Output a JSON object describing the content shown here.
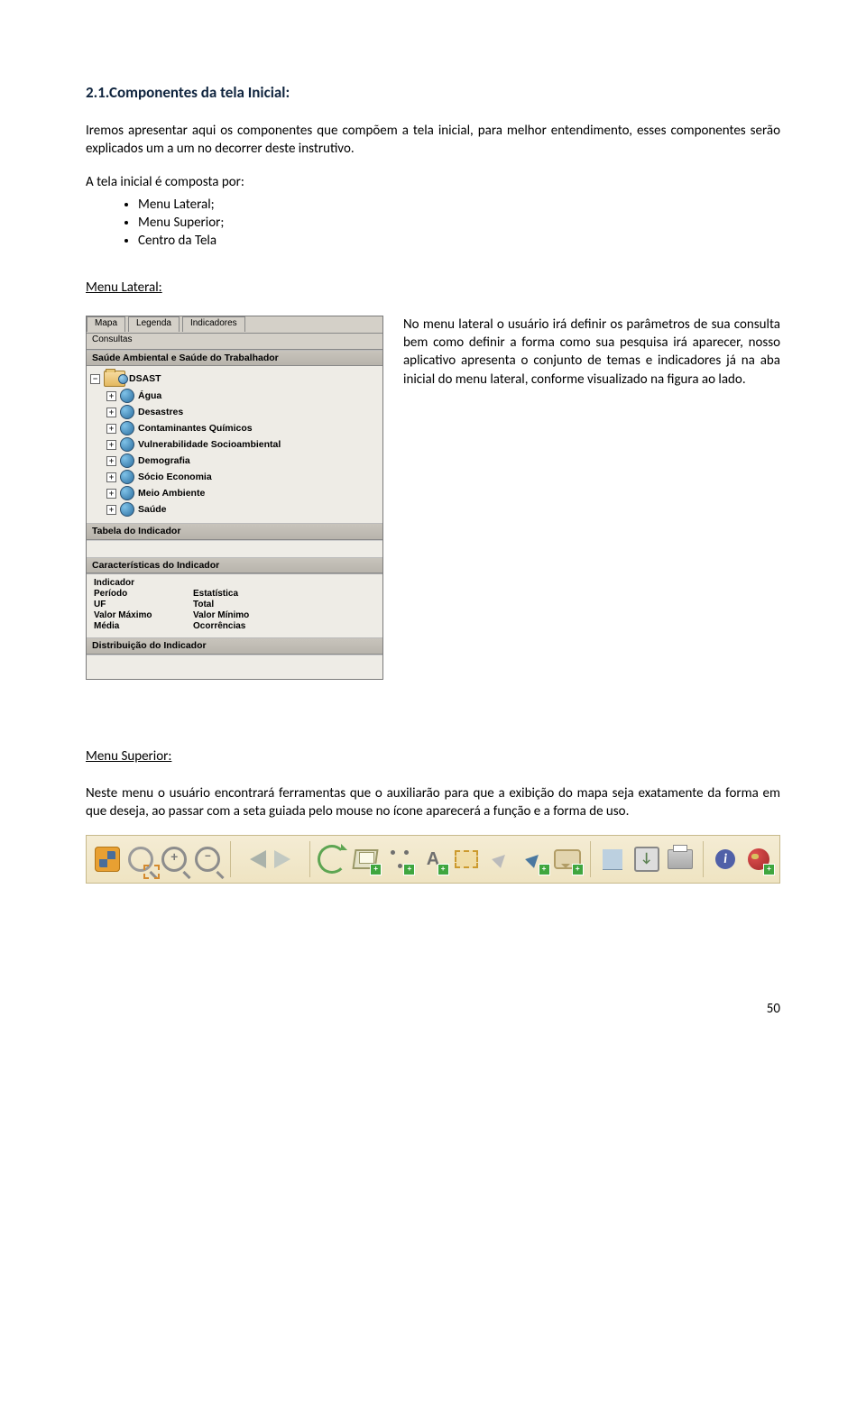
{
  "section": {
    "title": "2.1.Componentes da tela Inicial:",
    "intro": "Iremos apresentar aqui os componentes que compõem a tela inicial, para melhor entendimento, esses componentes serão explicados um a um no decorrer deste instrutivo.",
    "composed": "A tela inicial é composta por:",
    "bullets": [
      "Menu Lateral;",
      "Menu Superior;",
      "Centro da Tela"
    ]
  },
  "menu_lateral": {
    "heading": "Menu Lateral:",
    "desc": "No menu lateral o usuário irá definir os parâmetros de sua consulta bem como definir a forma como sua pesquisa irá aparecer, nosso aplicativo apresenta o conjunto de temas e indicadores já na aba inicial do menu lateral, conforme visualizado na figura ao lado.",
    "tabs": [
      "Mapa",
      "Legenda",
      "Indicadores"
    ],
    "subtab": "Consultas",
    "group_header": "Saúde Ambiental e Saúde do Trabalhador",
    "tree_root": "DSAST",
    "tree_items": [
      "Água",
      "Desastres",
      "Contaminantes Químicos",
      "Vulnerabilidade Socioambiental",
      "Demografia",
      "Sócio Economia",
      "Meio Ambiente",
      "Saúde"
    ],
    "header_tabela": "Tabela do Indicador",
    "header_caract": "Características do Indicador",
    "chars": [
      [
        "Indicador",
        ""
      ],
      [
        "Período",
        "Estatística"
      ],
      [
        "UF",
        "Total"
      ],
      [
        "Valor Máximo",
        "Valor Mínimo"
      ],
      [
        "Média",
        "Ocorrências"
      ]
    ],
    "header_dist": "Distribuição do Indicador"
  },
  "menu_superior": {
    "heading": "Menu Superior:",
    "desc": "Neste menu o usuário encontrará ferramentas que o auxiliarão para que a exibição do mapa seja exatamente da forma em que deseja, ao passar com a seta guiada pelo mouse no ícone aparecerá a função e a forma de uso.",
    "tools": [
      "full-extent-icon",
      "zoom-box-icon",
      "zoom-in-icon",
      "zoom-out-icon",
      "prev-extent-icon",
      "next-extent-icon",
      "refresh-icon",
      "layers-icon",
      "features-icon",
      "label-icon",
      "select-rect-icon",
      "pointer-icon",
      "identify-icon",
      "annotation-icon",
      "legend-icon",
      "save-map-icon",
      "print-icon",
      "info-icon",
      "overview-icon"
    ]
  },
  "page_number": "50"
}
